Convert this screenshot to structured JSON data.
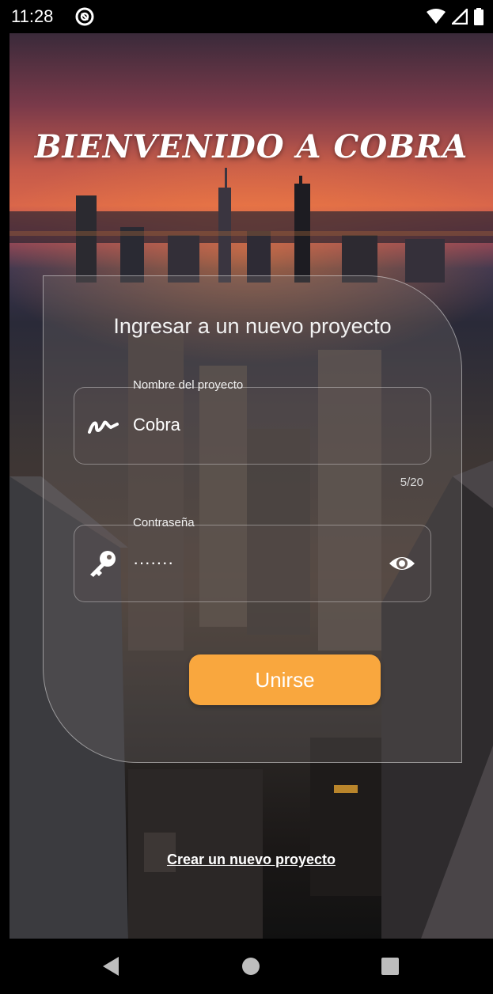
{
  "status_bar": {
    "time": "11:28",
    "icons": [
      "sync-icon",
      "wifi-icon",
      "signal-icon",
      "battery-icon"
    ]
  },
  "welcome_title": "BIENVENIDO A COBRA",
  "card": {
    "title": "Ingresar a un nuevo proyecto",
    "project_field": {
      "label": "Nombre del proyecto",
      "value": "Cobra",
      "counter": "5/20",
      "icon": "signature-icon"
    },
    "password_field": {
      "label": "Contraseña",
      "value": "·······",
      "icon": "key-icon",
      "toggle_icon": "eye-icon"
    },
    "join_button": "Unirse"
  },
  "create_link": "Crear un nuevo proyecto",
  "nav_bar": {
    "buttons": [
      "back-icon",
      "home-icon",
      "recents-icon"
    ]
  },
  "colors": {
    "accent": "#f9a73e",
    "text": "#ffffff"
  }
}
